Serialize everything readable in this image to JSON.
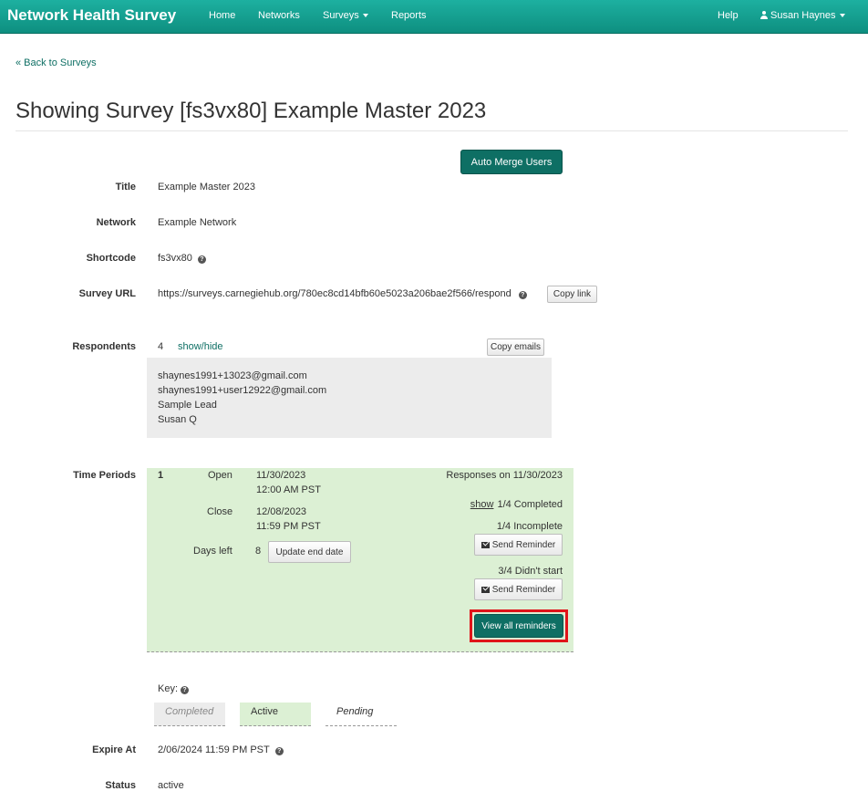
{
  "nav": {
    "brand": "Network Health Survey",
    "links": [
      "Home",
      "Networks",
      "Surveys",
      "Reports"
    ],
    "help": "Help",
    "user": "Susan Haynes"
  },
  "back_link": "« Back to Surveys",
  "page_title": "Showing Survey [fs3vx80] Example Master 2023",
  "auto_merge_label": "Auto Merge Users",
  "fields": {
    "title_label": "Title",
    "title_value": "Example Master 2023",
    "network_label": "Network",
    "network_value": "Example Network",
    "shortcode_label": "Shortcode",
    "shortcode_value": "fs3vx80",
    "url_label": "Survey URL",
    "url_value": "https://surveys.carnegiehub.org/780ec8cd14bfb60e5023a206bae2f566/respond",
    "copy_link_label": "Copy link",
    "respondents_label": "Respondents",
    "respondents_count": "4",
    "show_hide": "show/hide",
    "copy_emails_label": "Copy emails",
    "expire_label": "Expire At",
    "expire_value": "2/06/2024 11:59 PM PST",
    "status_label": "Status",
    "status_value": "active"
  },
  "respondents": [
    "shaynes1991+13023@gmail.com",
    "shaynes1991+user12922@gmail.com",
    "Sample Lead",
    "Susan Q"
  ],
  "time_periods": {
    "label": "Time Periods",
    "index": "1",
    "open_label": "Open",
    "open_date": "11/30/2023",
    "open_time": "12:00 AM PST",
    "close_label": "Close",
    "close_date": "12/08/2023",
    "close_time": "11:59 PM PST",
    "days_left_label": "Days left",
    "days_left": "8",
    "update_end_label": "Update end date",
    "responses_on": "Responses on 11/30/2023",
    "show": "show",
    "completed": "1/4 Completed",
    "incomplete": "1/4 Incomplete",
    "send_reminder": "Send Reminder",
    "didnt_start": "3/4 Didn't start",
    "view_all_reminders": "View all reminders"
  },
  "key": {
    "label": "Key:",
    "completed": "Completed",
    "active": "Active",
    "pending": "Pending"
  },
  "colors": {
    "navbar": "#14a090",
    "primary_button": "#0e6f64",
    "active_period": "#dcf0d4",
    "highlight": "#e0141a"
  }
}
